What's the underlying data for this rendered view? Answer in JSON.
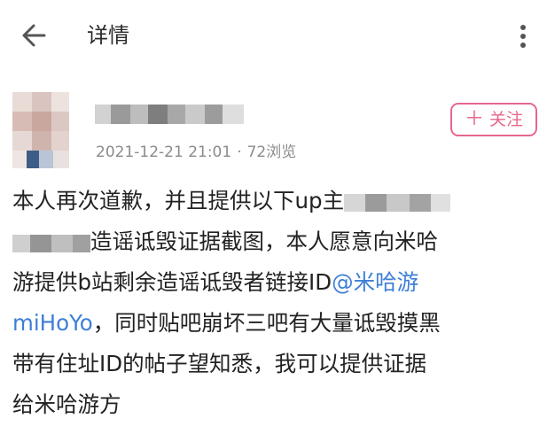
{
  "header": {
    "back_icon": "arrow-left-icon",
    "title": "详情",
    "more_icon": "more-vertical-icon"
  },
  "post": {
    "follow_label": "关注",
    "follow_icon": "plus-icon",
    "datetime": "2021-12-21 21:01",
    "separator": "·",
    "views": "72浏览",
    "body": {
      "line1": "本人再次道歉，并且提供以下up主",
      "line2": "造谣诋毁证据截图，本人愿意向米哈",
      "line3_text": "游提供b站剩余造谣诋毁者链接ID",
      "mention_part1": "@米哈游",
      "mention_part2": "miHoYo",
      "line4_text": "，同时贴吧崩坏三吧有大量诋毁摸黑",
      "line5": "带有住址ID的帖子望知悉，我可以提供证据",
      "line6": "给米哈游方"
    }
  },
  "colors": {
    "accent_pink": "#e8668c",
    "mention_blue": "#3d7fd6",
    "meta_gray": "#8b8b8b"
  }
}
